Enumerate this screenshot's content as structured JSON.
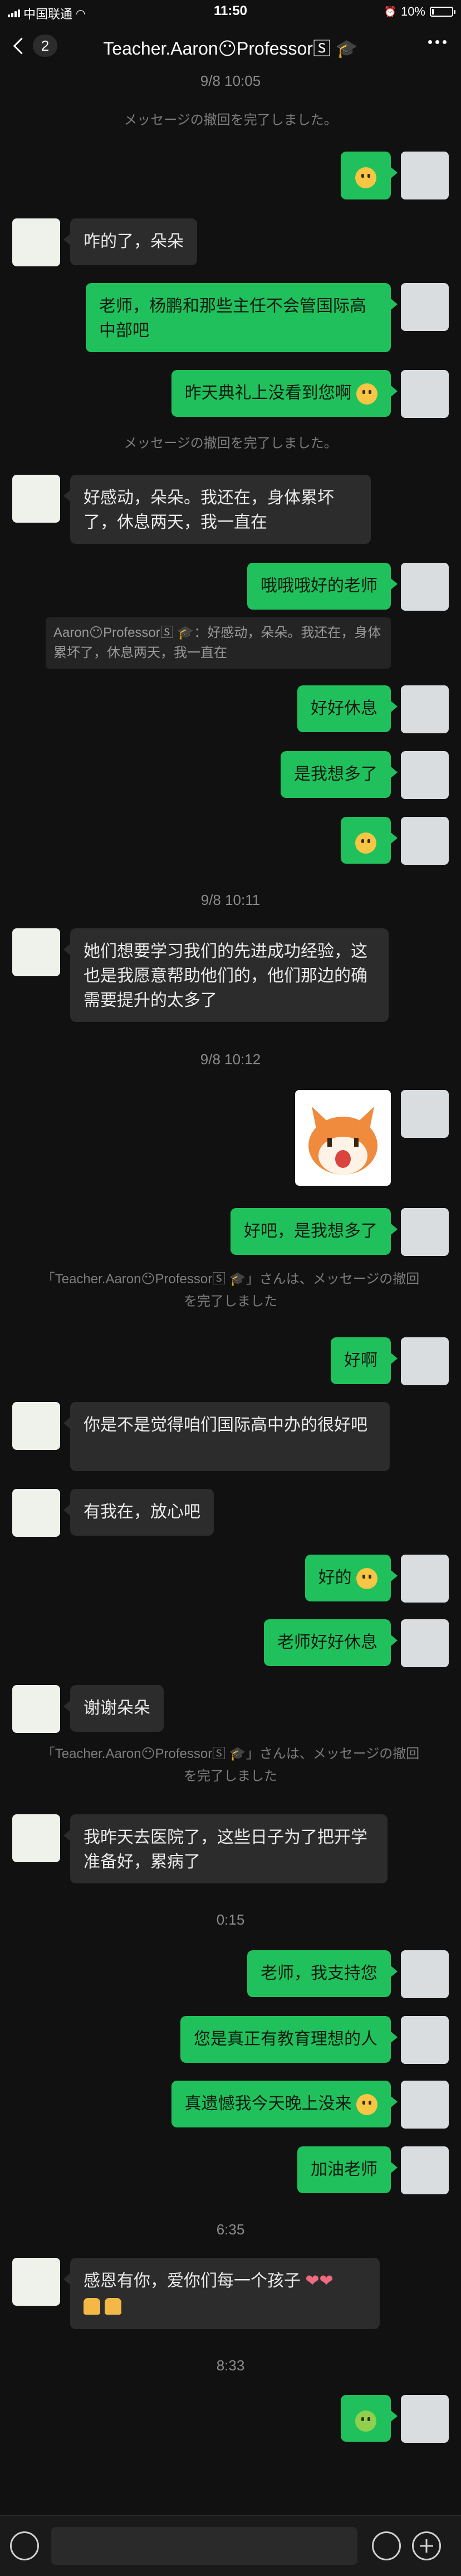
{
  "status": {
    "carrier": "中国联通",
    "time": "11:50",
    "battery": "10%",
    "battery_level": 0.1
  },
  "nav": {
    "back_count": "2",
    "title": "Teacher.Aaron😶Professor🅂 🎓"
  },
  "messages": {
    "ts1": "9/8 10:05",
    "sys1": "メッセージの撤回を完了しました。",
    "m2": "咋的了，朵朵",
    "m3": "老师，杨鹏和那些主任不会管国际高中部吧",
    "m4": "昨天典礼上没看到您啊",
    "sys2": "メッセージの撤回を完了しました。",
    "m5": "好感动，朵朵。我还在，身体累坏了，休息两天，我一直在",
    "m6": "哦哦哦好的老师",
    "quote1": "Aaron😶Professor🅂 🎓：好感动，朵朵。我还在，身体累坏了，休息两天，我一直在",
    "m7": "好好休息",
    "m8": "是我想多了",
    "ts2": "9/8 10:11",
    "m9": "她们想要学习我们的先进成功经验，这也是我愿意帮助他们的，他们那边的确需要提升的太多了",
    "ts3": "9/8 10:12",
    "m10": "好吧，是我想多了",
    "sys3": "「Teacher.Aaron😶Professor🅂 🎓」さんは、メッセージの撤回を完了しました",
    "m11": "好啊",
    "m12": "你是不是觉得咱们国际高中办的很好吧",
    "m13": "有我在，放心吧",
    "m14": "好的",
    "m15": "老师好好休息",
    "m16": "谢谢朵朵",
    "sys4": "「Teacher.Aaron😶Professor🅂 🎓」さんは、メッセージの撤回を完了しました",
    "m17": "我昨天去医院了，这些日子为了把开学准备好，累病了",
    "ts4": "0:15",
    "m18": "老师，我支持您",
    "m19": "您是真正有教育理想的人",
    "m20": "真遗憾我今天晚上没来",
    "m21": "加油老师",
    "ts5": "6:35",
    "m22": "感恩有你，爱你们每一个孩子",
    "ts6": "8:33"
  }
}
